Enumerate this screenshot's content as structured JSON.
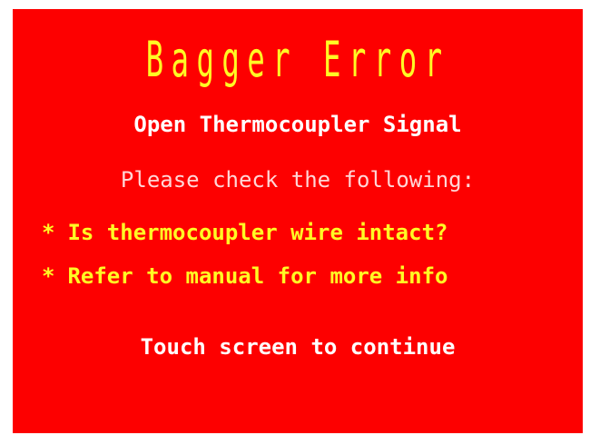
{
  "colors": {
    "background": "#fd0000",
    "title": "#fffa24",
    "subtitle": "#ffffff",
    "prompt": "#ffd6d6",
    "items": "#fffa24",
    "continue": "#ffffff"
  },
  "error": {
    "title": "Bagger Error",
    "message": "Open Thermocoupler Signal",
    "check_prompt": "Please check the following:",
    "checklist": [
      {
        "bullet": "*",
        "text": "Is thermocoupler wire intact?"
      },
      {
        "bullet": "*",
        "text": "Refer to manual for more info"
      }
    ],
    "continue_label": "Touch screen to continue"
  }
}
